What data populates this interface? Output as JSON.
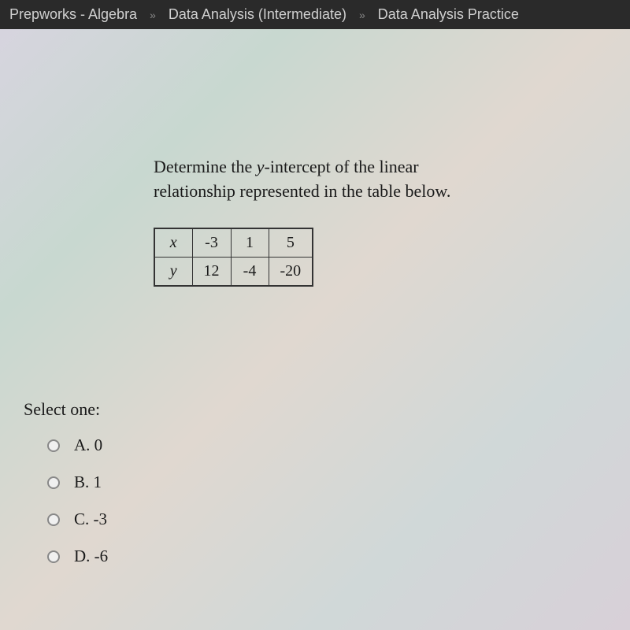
{
  "breadcrumb": {
    "item1": "Prepworks - Algebra",
    "item2": "Data Analysis (Intermediate)",
    "item3": "Data Analysis Practice"
  },
  "question": {
    "line1_before": "Determine the ",
    "line1_italic": "y",
    "line1_after": "-intercept of the linear",
    "line2": "relationship represented in the table below."
  },
  "table": {
    "row1_label": "x",
    "row1_vals": [
      "-3",
      "1",
      "5"
    ],
    "row2_label": "y",
    "row2_vals": [
      "12",
      "-4",
      "-20"
    ]
  },
  "select_prompt": "Select one:",
  "options": {
    "a": "A. 0",
    "b": "B. 1",
    "c": "C. -3",
    "d": "D. -6"
  },
  "chart_data": {
    "type": "table",
    "title": "Linear relationship data",
    "rows": [
      {
        "label": "x",
        "values": [
          -3,
          1,
          5
        ]
      },
      {
        "label": "y",
        "values": [
          12,
          -4,
          -20
        ]
      }
    ]
  }
}
